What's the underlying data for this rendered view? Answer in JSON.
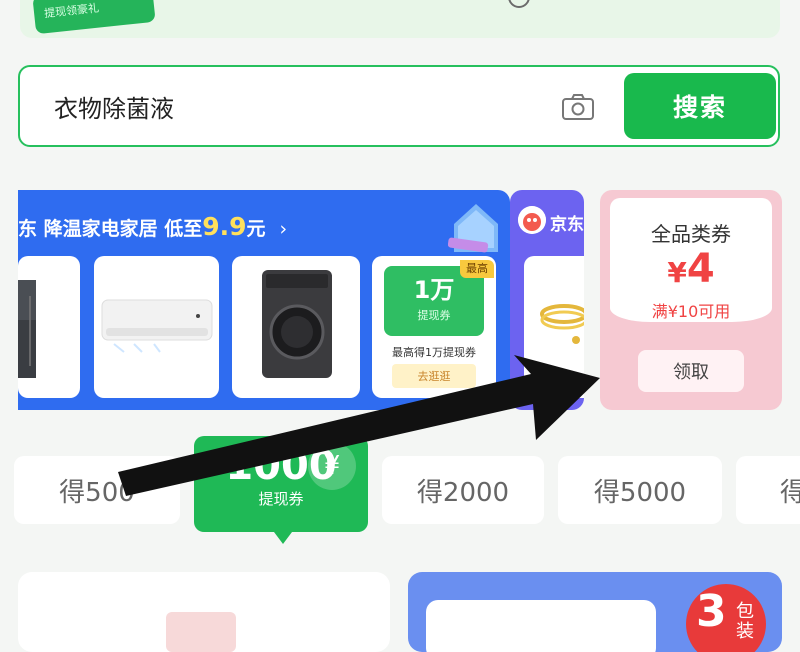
{
  "top_banner": {
    "badge_text": "提现领豪礼"
  },
  "search": {
    "query": "衣物除菌液",
    "button_label": "搜索",
    "camera_icon": "camera-icon"
  },
  "promo": {
    "header_prefix": "东 降温家电家居 低至",
    "header_price": "9.9",
    "header_suffix": "元",
    "chevron": "›",
    "coupon_card": {
      "amount": "1万",
      "sub": "提现券",
      "tag": "最高",
      "desc": "最高得1万提现券",
      "button": "去逛逛"
    }
  },
  "promo2": {
    "brand": "京东"
  },
  "coupon": {
    "title": "全品类券",
    "currency": "¥",
    "amount": "4",
    "condition": "满¥10可用",
    "claim_label": "领取"
  },
  "tiers": {
    "t500": "得500",
    "selected_amount": "1000",
    "selected_sub": "提现券",
    "t2000": "得2000",
    "t5000": "得5000",
    "more": "得"
  },
  "bottom": {
    "badge_num": "3",
    "badge_text": "包装"
  },
  "colors": {
    "accent_green": "#19b94d",
    "promo_blue": "#2f6cf0",
    "coupon_pink": "#f6c9d2",
    "price_red": "#f04343"
  }
}
